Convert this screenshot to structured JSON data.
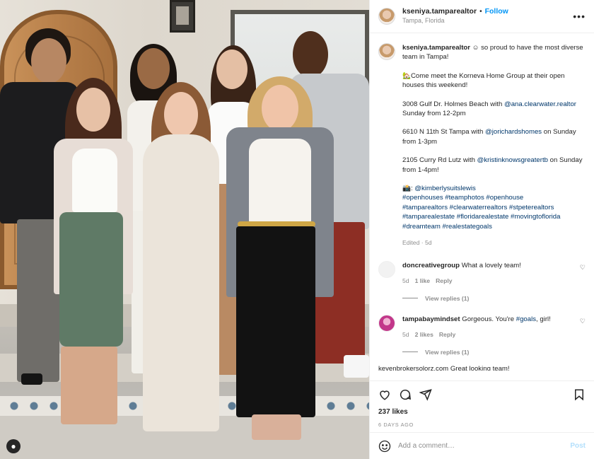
{
  "header": {
    "username": "kseniya.tamparealtor",
    "separator": "•",
    "follow_label": "Follow",
    "location": "Tampa, Florida",
    "more_icon": "more-horizontal-icon"
  },
  "caption": {
    "username": "kseniya.tamparealtor",
    "line1": " ☺ so proud to have the most diverse team in Tampa!",
    "intro": "🏡Come meet the Korneva Home Group at their open houses this weekend!",
    "house1_text": "3008 Gulf Dr. Holmes Beach with ",
    "house1_agent": "@ana.clearwater.realtor",
    "house1_time": " Sunday from 12-2pm",
    "house2_text": "6610 N 11th St Tampa with ",
    "house2_agent": "@jorichardshomes",
    "house2_time": " on Sunday from 1-3pm",
    "house3_text": "2105 Curry Rd Lutz with ",
    "house3_agent": "@kristinknowsgreatertb",
    "house3_time": " on Sunday from 1-4pm!",
    "photo_credit_emoji": "📸: ",
    "photo_credit": "@kimberlysuitslewis",
    "hashtags_1": "#openhouses #teamphotos #openhouse",
    "hashtags_2": "#tamparealtors #clearwaterrealtors #stpeterealtors",
    "hashtags_3": "#tamparealestate #floridarealestate #movingtoflorida",
    "hashtags_4": "#dreamteam #realestategoals",
    "meta": "Edited · 5d"
  },
  "comments": [
    {
      "username": "doncreativegroup",
      "text": " What a lovely team!",
      "age": "5d",
      "likes": "1 like",
      "reply": "Reply",
      "view_replies": "View replies (1)",
      "avatar_color": "#f2f2f2"
    },
    {
      "username": "tampabaymindset",
      "text_before": " Gorgeous. You're ",
      "tag": "#goals",
      "text_after": ", girl!",
      "age": "5d",
      "likes": "2 likes",
      "reply": "Reply",
      "view_replies": "View replies (1)",
      "avatar_color": "#c2378a"
    }
  ],
  "partial_comment": "kevenbrokersolorz.com  Great looking team!",
  "actions": {
    "likes": "237 likes",
    "time_ago": "6 DAYS AGO"
  },
  "add_comment": {
    "placeholder": "Add a comment…",
    "post_label": "Post"
  },
  "colors": {
    "accent": "#0095f6",
    "link": "#00376b",
    "muted": "#8e8e8e",
    "post_disabled": "#b2dffc"
  }
}
